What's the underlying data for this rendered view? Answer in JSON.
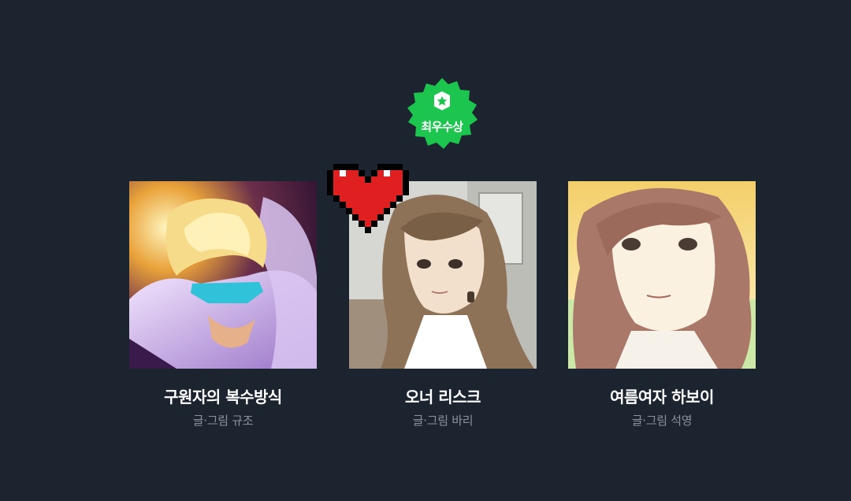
{
  "award": {
    "label": "최우수상",
    "icon": "star-badge-icon",
    "color": "#1cc64e"
  },
  "works": [
    {
      "title": "구원자의 복수방식",
      "author": "글·그림 규조"
    },
    {
      "title": "오너 리스크",
      "author": "글·그림 바리"
    },
    {
      "title": "여름여자 하보이",
      "author": "글·그림 석영"
    }
  ],
  "decoration": {
    "icon": "pixel-heart-icon",
    "color": "#e02020"
  }
}
